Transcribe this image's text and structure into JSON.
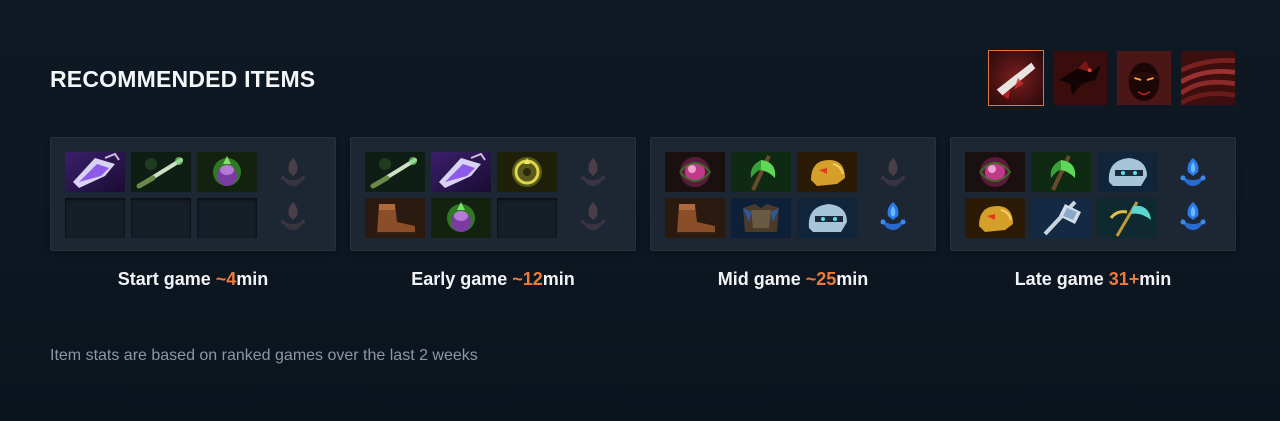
{
  "section": {
    "title": "RECOMMENDED ITEMS",
    "footnote": "Item stats are based on ranked games over the last 2 weeks"
  },
  "hero_tabs": [
    {
      "name": "facet-1",
      "icon": "blade-icon",
      "active": true
    },
    {
      "name": "facet-2",
      "icon": "raven-icon",
      "active": false
    },
    {
      "name": "facet-3",
      "icon": "hero-portrait-icon",
      "active": false
    },
    {
      "name": "facet-4",
      "icon": "scales-icon",
      "active": false
    }
  ],
  "stages": [
    {
      "label_prefix": "Start game ",
      "time": "~4",
      "unit": "min",
      "items": [
        "magic-stick-icon",
        "tango-icon",
        "faerie-fire-icon",
        "empty",
        "empty",
        "empty"
      ],
      "neutrals": [
        "neutral-dim",
        "neutral-dim"
      ]
    },
    {
      "label_prefix": "Early game ",
      "time": "~12",
      "unit": "min",
      "items": [
        "tango-icon",
        "magic-stick-icon",
        "ring-of-basilius-icon",
        "boots-icon",
        "faerie-fire-icon",
        "empty"
      ],
      "neutrals": [
        "neutral-dim",
        "neutral-dim"
      ]
    },
    {
      "label_prefix": "Mid game ",
      "time": "~25",
      "unit": "min",
      "items": [
        "orb-icon",
        "axe-icon",
        "helm-icon",
        "boots-icon",
        "armor-icon",
        "mask-icon"
      ],
      "neutrals": [
        "neutral-dim",
        "neutral-blue"
      ]
    },
    {
      "label_prefix": "Late game ",
      "time": "31+",
      "unit": "min",
      "items": [
        "orb-icon",
        "axe-icon",
        "mask-icon",
        "helm-icon",
        "hammer-icon",
        "scythe-icon"
      ],
      "neutrals": [
        "neutral-blue",
        "neutral-blue"
      ]
    }
  ],
  "colors": {
    "accent": "#f0793a",
    "panel": "#1d2733",
    "background": "#0f1924"
  }
}
